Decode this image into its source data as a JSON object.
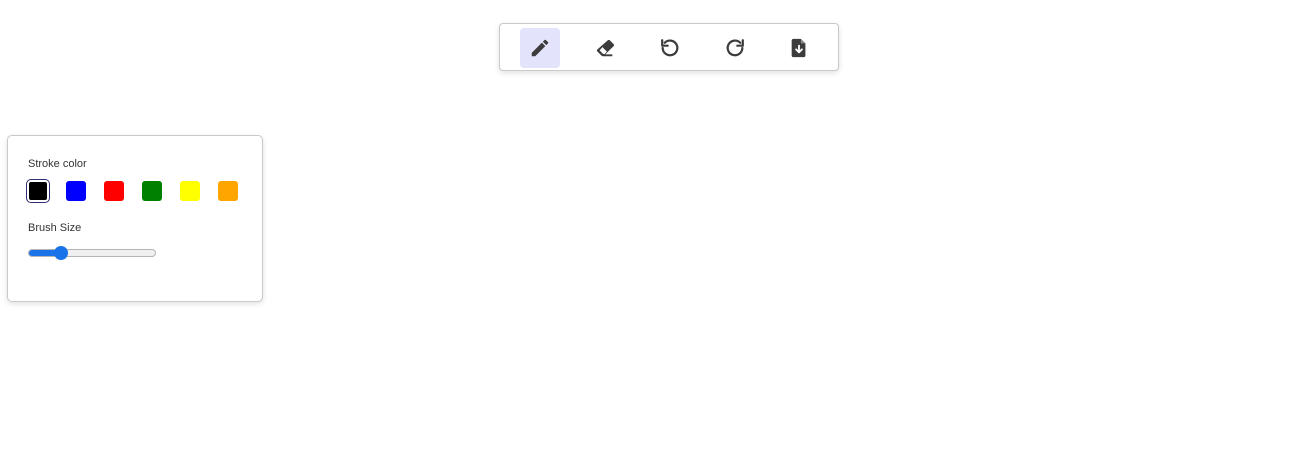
{
  "toolbar": {
    "tools": [
      {
        "name": "pencil",
        "icon": "pencil-icon",
        "active": true
      },
      {
        "name": "eraser",
        "icon": "eraser-icon",
        "active": false
      },
      {
        "name": "undo",
        "icon": "undo-icon",
        "active": false
      },
      {
        "name": "redo",
        "icon": "redo-icon",
        "active": false
      },
      {
        "name": "export",
        "icon": "file-download-icon",
        "active": false
      }
    ],
    "active_color": "#e3e3fb",
    "icon_color": "#3c3c3c"
  },
  "panel": {
    "stroke_color_label": "Stroke color",
    "colors": [
      "#000000",
      "#0000ff",
      "#ff0000",
      "#008000",
      "#ffff00",
      "#ffa500"
    ],
    "selected_color": "#000000",
    "brush_size_label": "Brush Size",
    "brush_size_fraction": 0.26,
    "slider_accent": "#1a73e8"
  }
}
